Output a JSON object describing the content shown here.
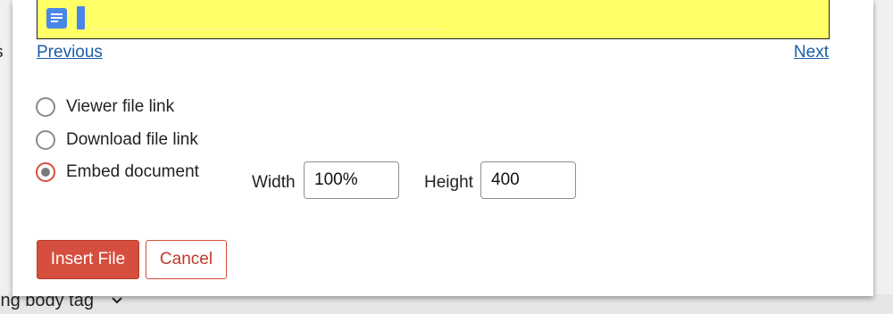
{
  "background": {
    "left_fragment": "s",
    "bottom_fragment": "ing body tag",
    "bottom_icon": "chevron-down-icon"
  },
  "preview": {
    "background_color": "#ffff66",
    "icon": "google-doc-icon"
  },
  "navigation": {
    "previous_label": "Previous",
    "next_label": "Next"
  },
  "options": [
    {
      "label": "Viewer file link",
      "checked": false
    },
    {
      "label": "Download file link",
      "checked": false
    },
    {
      "label": "Embed document",
      "checked": true
    }
  ],
  "embed": {
    "width_label": "Width",
    "width_value": "100%",
    "height_label": "Height",
    "height_value": "400"
  },
  "buttons": {
    "insert_label": "Insert File",
    "cancel_label": "Cancel"
  },
  "colors": {
    "accent": "#d64e3d",
    "link": "#1a5ea8"
  }
}
